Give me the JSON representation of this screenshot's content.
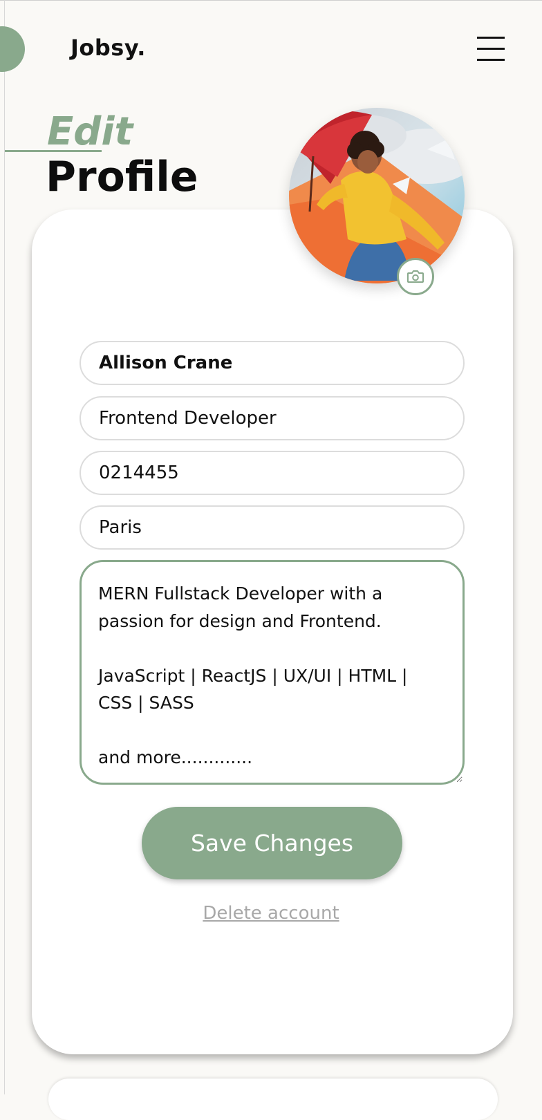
{
  "header": {
    "logo": "Jobsy.",
    "menu_icon": "hamburger-menu-icon"
  },
  "page": {
    "title_accent": "Edit",
    "title_main": "Profile"
  },
  "profile": {
    "avatar_icon": "profile-photo",
    "camera_icon": "camera-icon",
    "name": "Allison Crane",
    "role": "Frontend Developer",
    "phone": "0214455",
    "city": "Paris",
    "bio": "MERN Fullstack Developer with a passion for design and Frontend.\n\nJavaScript | ReactJS | UX/UI | HTML | CSS | SASS\n\nand more............."
  },
  "actions": {
    "save_label": "Save Changes",
    "delete_label": "Delete account"
  },
  "colors": {
    "accent": "#89a98c",
    "background": "#faf9f6",
    "card": "#ffffff",
    "muted_link": "#a8a8a8"
  }
}
